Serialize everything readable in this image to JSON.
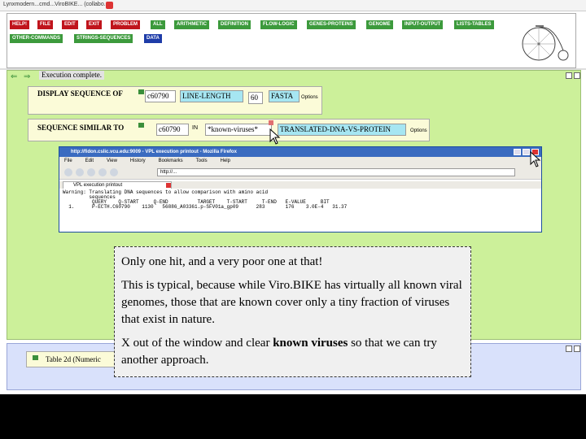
{
  "window": {
    "title": "Lynxmodern...cmd...ViroBIKE... (collabo..."
  },
  "command_buttons": [
    {
      "label": "HELP!",
      "color": "red"
    },
    {
      "label": "FILE",
      "color": "red"
    },
    {
      "label": "EDIT",
      "color": "red"
    },
    {
      "label": "EXIT",
      "color": "red"
    },
    {
      "label": "PROBLEM",
      "color": "red"
    },
    {
      "label": "ALL",
      "color": "green"
    },
    {
      "label": "ARITHMETIC",
      "color": "green"
    },
    {
      "label": "DEFINITION",
      "color": "green"
    },
    {
      "label": "FLOW-LOGIC",
      "color": "green"
    },
    {
      "label": "GENES-PROTEINS",
      "color": "green"
    },
    {
      "label": "GENOME",
      "color": "green"
    },
    {
      "label": "INPUT-OUTPUT",
      "color": "green"
    },
    {
      "label": "LISTS-TABLES",
      "color": "green"
    },
    {
      "label": "OTHER-COMMANDS",
      "color": "green"
    },
    {
      "label": "STRINGS-SEQUENCES",
      "color": "green"
    },
    {
      "label": "DATA",
      "color": "blue"
    }
  ],
  "workspace": {
    "status": "Execution complete."
  },
  "block_display": {
    "title": "DISPLAY SEQUENCE OF",
    "arg1": "c60790",
    "keyword": "LINE-LENGTH",
    "arg2": "60",
    "keyword2": "FASTA",
    "options": "Options"
  },
  "block_similar": {
    "title": "SEQUENCE SIMILAR TO",
    "arg1": "c60790",
    "in_label": "IN",
    "arg2": "*known-viruses*",
    "keyword": "TRANSLATED-DNA-VS-PROTEIN",
    "options": "Options"
  },
  "firefox": {
    "title": "http://fidon.cslic.vcu.edu:9009 - VPL execution printout - Mozilla Firefox",
    "menu": [
      "File",
      "Edit",
      "View",
      "History",
      "Bookmarks",
      "Tools",
      "Help"
    ],
    "url": "http://...",
    "tab": "VPL execution printout",
    "content": "Warning: Translating DNA sequences to allow comparison with amino acid\n         sequences\n          QUERY    Q-START     Q-END          TARGET    T-START     T-END   E-VALUE     BIT\n  1.      P-ECTH.C60790    1130   56886_A03361.p-SFV01a_gp09      283       176    3.0E-4   31.37"
  },
  "callout": {
    "p1": "Only one hit, and a very poor one at that!",
    "p2": "This is typical, because while Viro.BIKE has virtually all known viral genomes, those that are known cover only a tiny fraction of viruses that exist in nature.",
    "p3_before": "X out of the window and clear ",
    "p3_bold": "known viruses",
    "p3_after": " so that we can try another approach."
  },
  "panel2": {
    "block_label": "Table 2d (Numeric"
  }
}
